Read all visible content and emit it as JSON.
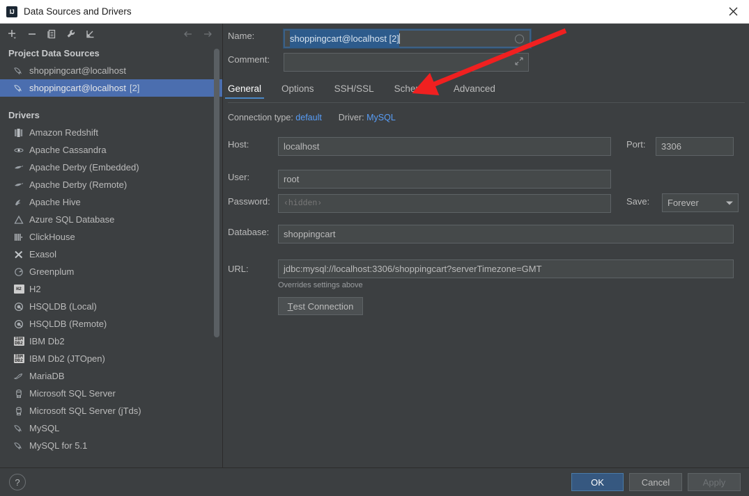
{
  "window": {
    "title": "Data Sources and Drivers",
    "app_icon": "IJ",
    "close_icon": "close-icon"
  },
  "toolbar": {
    "buttons": [
      {
        "name": "add-button",
        "icon": "plus-icon",
        "label": "Add"
      },
      {
        "name": "remove-button",
        "icon": "minus-icon",
        "label": "Remove"
      },
      {
        "name": "copy-button",
        "icon": "copy-icon",
        "label": "Copy"
      },
      {
        "name": "properties-button",
        "icon": "wrench-icon",
        "label": "Properties"
      },
      {
        "name": "import-button",
        "icon": "import-arrow-icon",
        "label": "Import"
      }
    ],
    "nav": [
      {
        "name": "back-button",
        "icon": "arrow-left-icon",
        "label": "Back"
      },
      {
        "name": "forward-button",
        "icon": "arrow-right-icon",
        "label": "Forward"
      }
    ]
  },
  "sidebar": {
    "project_group_label": "Project Data Sources",
    "data_sources": [
      {
        "label": "shoppingcart@localhost",
        "suffix": "",
        "icon": "mysql-dolphin-icon",
        "selected": false
      },
      {
        "label": "shoppingcart@localhost",
        "suffix": "[2]",
        "icon": "mysql-dolphin-icon",
        "selected": true
      }
    ],
    "drivers_group_label": "Drivers",
    "drivers": [
      {
        "label": "Amazon Redshift",
        "icon": "redshift-icon"
      },
      {
        "label": "Apache Cassandra",
        "icon": "cassandra-icon"
      },
      {
        "label": "Apache Derby (Embedded)",
        "icon": "derby-icon"
      },
      {
        "label": "Apache Derby (Remote)",
        "icon": "derby-icon"
      },
      {
        "label": "Apache Hive",
        "icon": "hive-icon"
      },
      {
        "label": "Azure SQL Database",
        "icon": "azure-icon"
      },
      {
        "label": "ClickHouse",
        "icon": "clickhouse-icon"
      },
      {
        "label": "Exasol",
        "icon": "exasol-icon"
      },
      {
        "label": "Greenplum",
        "icon": "greenplum-icon"
      },
      {
        "label": "H2",
        "icon": "h2-icon"
      },
      {
        "label": "HSQLDB (Local)",
        "icon": "hsqldb-icon"
      },
      {
        "label": "HSQLDB (Remote)",
        "icon": "hsqldb-icon"
      },
      {
        "label": "IBM Db2",
        "icon": "ibm-db2-icon"
      },
      {
        "label": "IBM Db2 (JTOpen)",
        "icon": "ibm-db2-icon"
      },
      {
        "label": "MariaDB",
        "icon": "mariadb-icon"
      },
      {
        "label": "Microsoft SQL Server",
        "icon": "mssql-icon"
      },
      {
        "label": "Microsoft SQL Server (jTds)",
        "icon": "mssql-icon"
      },
      {
        "label": "MySQL",
        "icon": "mysql-dolphin-icon"
      },
      {
        "label": "MySQL for 5.1",
        "icon": "mysql-dolphin-icon"
      }
    ]
  },
  "form": {
    "name_label": "Name:",
    "name_value": "shoppingcart@localhost [2]",
    "comment_label": "Comment:",
    "comment_value": "",
    "tabs": [
      {
        "label": "General",
        "active": true
      },
      {
        "label": "Options",
        "active": false
      },
      {
        "label": "SSH/SSL",
        "active": false
      },
      {
        "label": "Schemas",
        "active": false
      },
      {
        "label": "Advanced",
        "active": false
      }
    ],
    "connection_type_label": "Connection type:",
    "connection_type_value": "default",
    "driver_label": "Driver:",
    "driver_value": "MySQL",
    "host_label": "Host:",
    "host_value": "localhost",
    "port_label": "Port:",
    "port_value": "3306",
    "user_label": "User:",
    "user_value": "root",
    "password_label": "Password:",
    "password_placeholder": "‹hidden›",
    "save_label": "Save:",
    "save_value": "Forever",
    "database_label": "Database:",
    "database_value": "shoppingcart",
    "url_label": "URL:",
    "url_value": "jdbc:mysql://localhost:3306/shoppingcart?serverTimezone=GMT",
    "url_hint": "Overrides settings above",
    "test_connection_mnemonic": "T",
    "test_connection_rest": "est Connection"
  },
  "footer": {
    "help_label": "?",
    "ok_label": "OK",
    "cancel_label": "Cancel",
    "apply_label": "Apply"
  },
  "annotation": {
    "arrow_color": "#f02020",
    "arrow_points_at": "Schemas"
  },
  "colors": {
    "background": "#3c3f41",
    "selection": "#4b6eaf",
    "accent_link": "#589df6",
    "tab_underline": "#4a88c7",
    "primary_button": "#365880",
    "titlebar": "#ffffff"
  }
}
